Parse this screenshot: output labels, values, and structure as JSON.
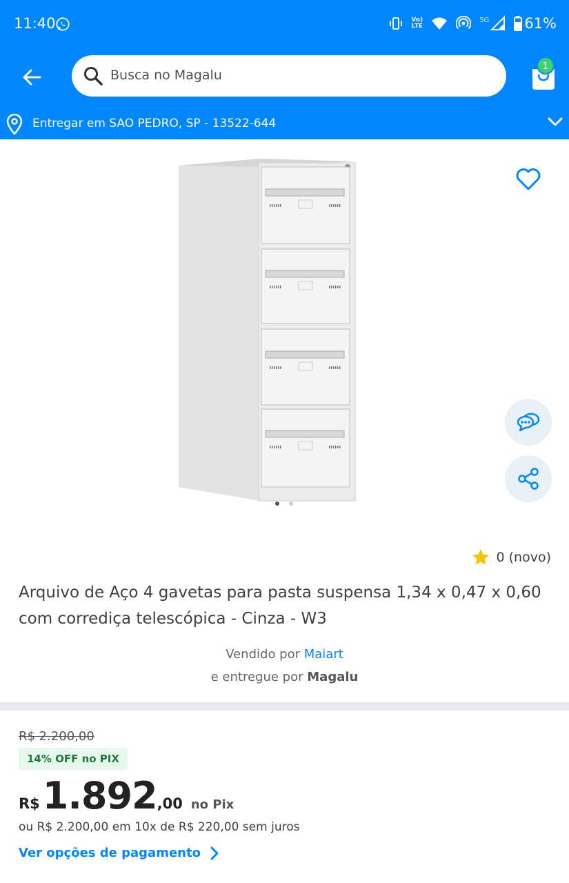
{
  "status_bar": {
    "time": "11:40",
    "battery": "61%",
    "network_label": "5G",
    "volte": "Vo\nLTE"
  },
  "header": {
    "search_placeholder": "Busca no Magalu",
    "cart_count": "1"
  },
  "delivery": {
    "text": "Entregar em SAO PEDRO, SP - 13522-644"
  },
  "gallery": {
    "active_index": 0,
    "total": 2
  },
  "product": {
    "rating_text": "0 (novo)",
    "title": "Arquivo de Aço 4 gavetas para pasta suspensa 1,34 x 0,47 x 0,60 com corrediça telescópica - Cinza - W3",
    "sold_by_label": "Vendido por",
    "seller_name": "Maiart",
    "delivered_by_label": "e entregue por",
    "delivered_by_name": "Magalu"
  },
  "price": {
    "old": "R$ 2.200,00",
    "pix_badge": "14% OFF no PIX",
    "currency": "R$",
    "integer": "1.892",
    "cents": ",00",
    "pix_suffix": "no Pix",
    "installments": "ou R$ 2.200,00 em 10x de R$ 220,00 sem juros",
    "payment_link": "Ver opções de pagamento"
  },
  "colors": {
    "brand_blue": "#0086ff",
    "badge_green": "#3fd16b",
    "star": "#f5c400"
  },
  "icons": [
    "whatsapp-icon",
    "vibrate-icon",
    "wifi-icon",
    "hotspot-icon",
    "signal-icon",
    "battery-icon",
    "back-arrow-icon",
    "search-icon",
    "cart-icon",
    "location-pin-icon",
    "chevron-down-icon",
    "heart-icon",
    "chat-icon",
    "share-icon",
    "star-icon",
    "chevron-right-icon"
  ]
}
